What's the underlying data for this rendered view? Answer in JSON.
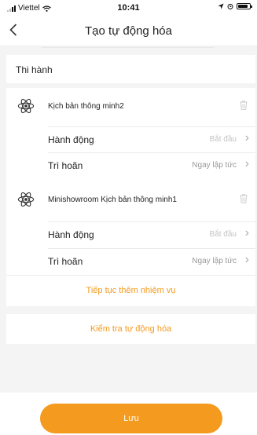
{
  "status_bar": {
    "carrier": "Viettel",
    "time": "10:41"
  },
  "nav": {
    "back_icon": "chevron-left-icon",
    "title": "Tạo tự động hóa"
  },
  "section": {
    "title": "Thi hành"
  },
  "scenes": [
    {
      "icon": "atom-icon",
      "name": "Kịch bản thông minh2",
      "action_label": "Hành động",
      "action_value": "Bắt đầu",
      "delay_label": "Trì hoãn",
      "delay_value": "Ngay lập tức"
    },
    {
      "icon": "atom-icon",
      "name": "Minishowroom Kịch bản thông minh1",
      "action_label": "Hành động",
      "action_value": "Bắt đầu",
      "delay_label": "Trì hoãn",
      "delay_value": "Ngay lập tức"
    }
  ],
  "add_task_label": "Tiếp tục thêm nhiệm vụ",
  "check_label": "Kiểm tra tự động hóa",
  "save_label": "Lưu",
  "colors": {
    "accent": "#f39a1f",
    "background": "#f4f4f4"
  }
}
